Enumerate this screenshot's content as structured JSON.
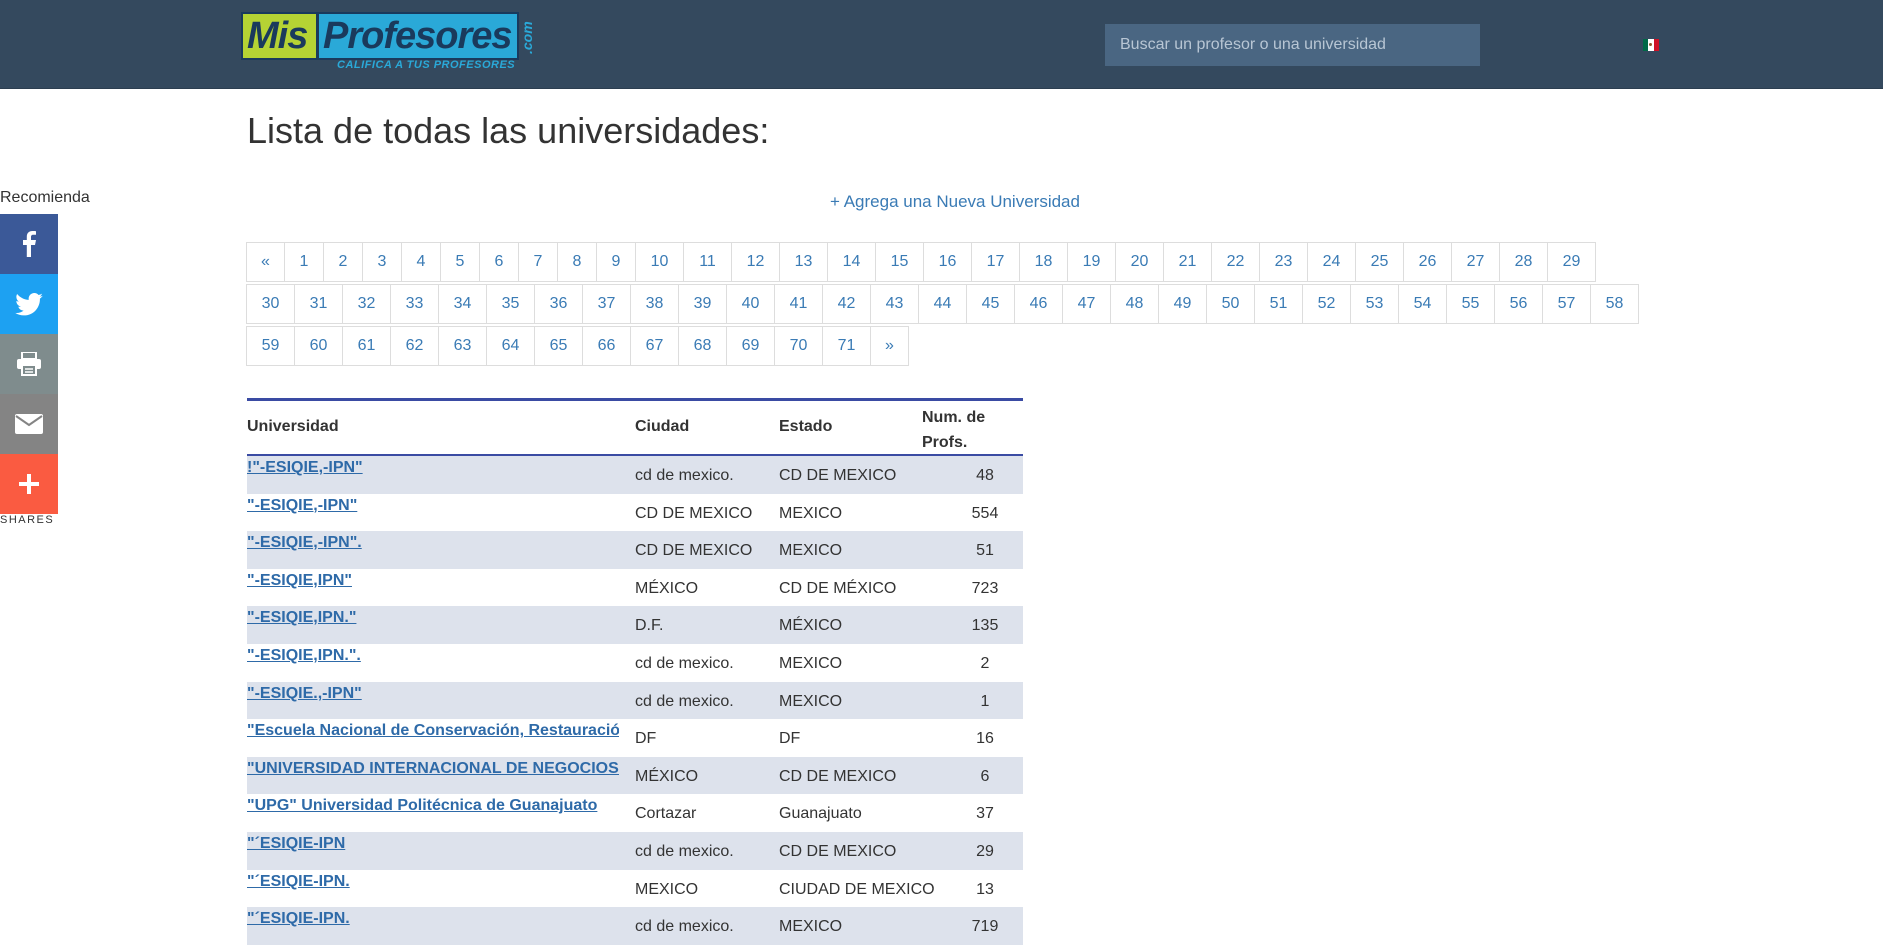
{
  "header": {
    "logo_mis": "Mis",
    "logo_profesores": "Profesores",
    "logo_dotcom": ".com",
    "logo_tagline": "CALIFICA A TUS PROFESORES",
    "search_placeholder": "Buscar un profesor o una universidad"
  },
  "page": {
    "title": "Lista de todas las universidades:",
    "add_link": "+ Agrega una Nueva Universidad"
  },
  "share": {
    "heading": "Recomienda",
    "shares_label": "SHARES",
    "buttons": [
      "facebook-icon",
      "twitter-icon",
      "print-icon",
      "email-icon",
      "plus-icon"
    ]
  },
  "pagination": {
    "row1": [
      "«",
      "1",
      "2",
      "3",
      "4",
      "5",
      "6",
      "7",
      "8",
      "9",
      "10",
      "11",
      "12",
      "13",
      "14",
      "15",
      "16",
      "17",
      "18",
      "19",
      "20",
      "21",
      "22",
      "23",
      "24",
      "25",
      "26",
      "27",
      "28",
      "29"
    ],
    "row2": [
      "30",
      "31",
      "32",
      "33",
      "34",
      "35",
      "36",
      "37",
      "38",
      "39",
      "40",
      "41",
      "42",
      "43",
      "44",
      "45",
      "46",
      "47",
      "48",
      "49",
      "50",
      "51",
      "52",
      "53",
      "54",
      "55",
      "56",
      "57",
      "58"
    ],
    "row3": [
      "59",
      "60",
      "61",
      "62",
      "63",
      "64",
      "65",
      "66",
      "67",
      "68",
      "69",
      "70",
      "71",
      "»"
    ]
  },
  "table": {
    "headers": {
      "name": "Universidad",
      "city": "Ciudad",
      "state": "Estado",
      "num_line1": "Num. de",
      "num_line2": "Profs."
    },
    "rows": [
      {
        "name": "!\"-ESIQIE,-IPN\"",
        "city": "cd de mexico.",
        "state": "CD DE MEXICO",
        "num": "48"
      },
      {
        "name": "\"-ESIQIE,-IPN\"",
        "city": "CD DE MEXICO",
        "state": "MEXICO",
        "num": "554"
      },
      {
        "name": "\"-ESIQIE,-IPN\".",
        "city": "CD DE MEXICO",
        "state": "MEXICO",
        "num": "51"
      },
      {
        "name": "\"-ESIQIE,IPN\"",
        "city": "MÉXICO",
        "state": "CD DE MÉXICO",
        "num": "723"
      },
      {
        "name": "\"-ESIQIE,IPN.\"",
        "city": "D.F.",
        "state": "MÉXICO",
        "num": "135"
      },
      {
        "name": "\"-ESIQIE,IPN.\".",
        "city": "cd de mexico.",
        "state": "MEXICO",
        "num": "2"
      },
      {
        "name": "\"-ESIQIE.,-IPN\"",
        "city": "cd de mexico.",
        "state": "MEXICO",
        "num": "1"
      },
      {
        "name": "\"Escuela Nacional de Conservación, Restauración y",
        "city": "DF",
        "state": "DF",
        "num": "16"
      },
      {
        "name": "\"UNIVERSIDAD INTERNACIONAL DE NEGOCIOS\"",
        "city": "MÉXICO",
        "state": "CD DE MEXICO",
        "num": "6"
      },
      {
        "name": "\"UPG\" Universidad Politécnica de Guanajuato",
        "city": "Cortazar",
        "state": "Guanajuato",
        "num": "37"
      },
      {
        "name": "\"´ESIQIE-IPN",
        "city": "cd de mexico.",
        "state": "CD DE MEXICO",
        "num": "29"
      },
      {
        "name": "\"´ESIQIE-IPN.",
        "city": "MEXICO",
        "state": "CIUDAD DE MEXICO",
        "num": "13"
      },
      {
        "name": "\"´ESIQIE-IPN.",
        "city": "cd de mexico.",
        "state": "MEXICO",
        "num": "719"
      }
    ]
  },
  "colors": {
    "header_bg": "#34495e",
    "search_bg": "#4a6682",
    "link": "#3a7bb5",
    "table_accent": "#3a4ba3",
    "row_stripe": "#dde2ec"
  }
}
